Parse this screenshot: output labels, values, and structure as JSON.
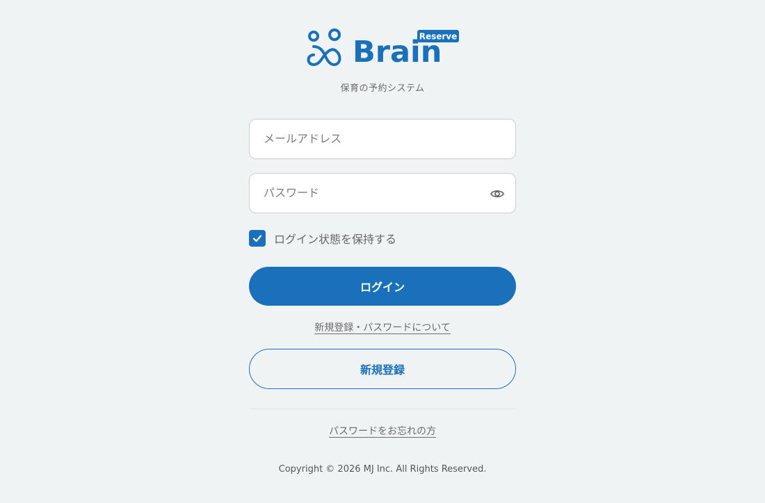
{
  "brand": {
    "name": "Brain",
    "badge": "Reserve",
    "tagline": "保育の予約システム",
    "color": "#1a71bb"
  },
  "login_form": {
    "email_placeholder": "メールアドレス",
    "email_value": "",
    "password_placeholder": "パスワード",
    "password_value": "",
    "show_password_icon": "eye-icon",
    "remember_label": "ログイン状態を保持する",
    "remember_checked": true,
    "login_button": "ログイン"
  },
  "links": {
    "register_info": "新規登録・パスワードについて",
    "forgot_password": "パスワードをお忘れの方"
  },
  "register_button": "新規登録",
  "footer": {
    "copyright": "Copyright © 2026 MJ Inc. All Rights Reserved."
  }
}
